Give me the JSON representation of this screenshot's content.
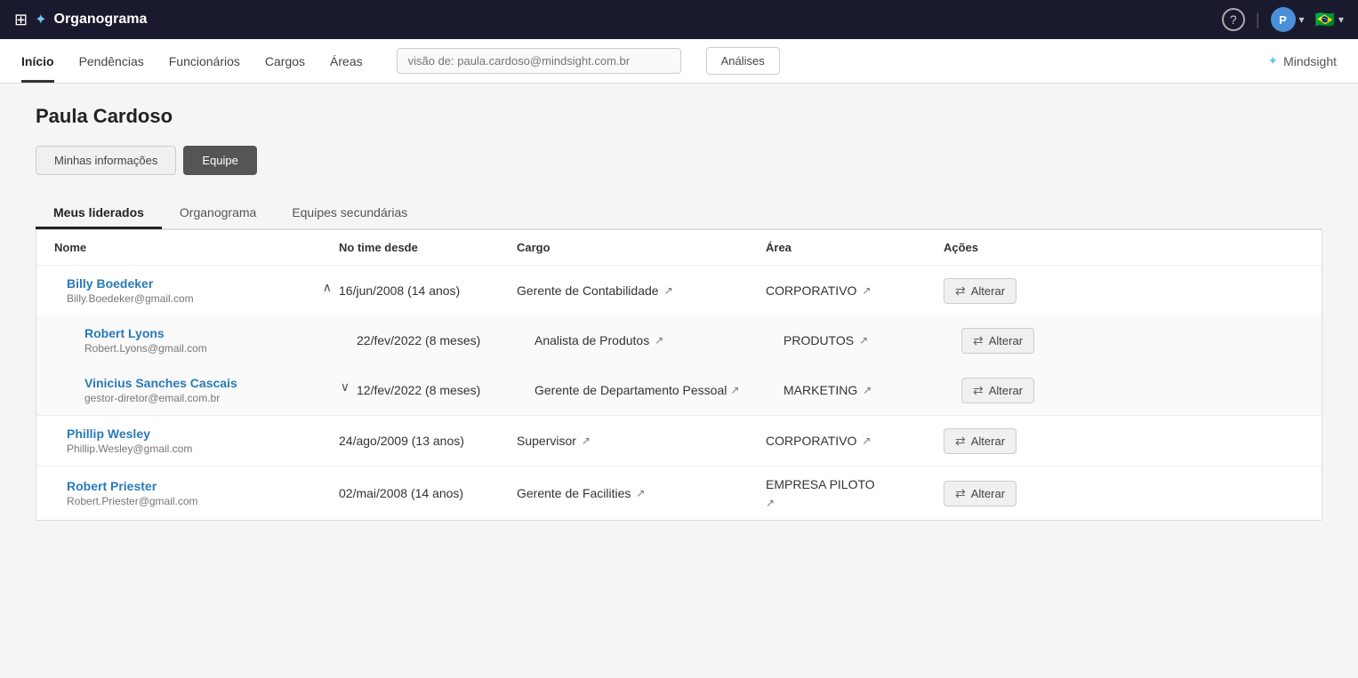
{
  "topbar": {
    "logo_icon": "⬛",
    "network_icon": "⬡",
    "title": "Organograma",
    "help_label": "?",
    "avatar_label": "P",
    "avatar_dropdown": "▾",
    "flag_emoji": "🇧🇷",
    "flag_dropdown": "▾"
  },
  "navbar": {
    "items": [
      {
        "label": "Início",
        "active": true
      },
      {
        "label": "Pendências",
        "active": false
      },
      {
        "label": "Funcionários",
        "active": false
      },
      {
        "label": "Cargos",
        "active": false
      },
      {
        "label": "Áreas",
        "active": false
      }
    ],
    "search_placeholder": "visão de: paula.cardoso@mindsight.com.br",
    "analyses_label": "Análises",
    "brand_label": "Mindsight",
    "brand_icon": "⬡"
  },
  "page": {
    "title": "Paula Cardoso",
    "tab_buttons": [
      {
        "label": "Minhas informações",
        "active": false
      },
      {
        "label": "Equipe",
        "active": true
      }
    ],
    "sub_tabs": [
      {
        "label": "Meus liderados",
        "active": true
      },
      {
        "label": "Organograma",
        "active": false
      },
      {
        "label": "Equipes secundárias",
        "active": false
      }
    ]
  },
  "table": {
    "headers": {
      "nome": "Nome",
      "desde": "No time desde",
      "cargo": "Cargo",
      "area": "Área",
      "acoes": "Ações"
    },
    "rows": [
      {
        "id": "billy",
        "name": "Billy Boedeker",
        "email": "Billy.Boedeker@gmail.com",
        "since": "16/jun/2008 (14 anos)",
        "cargo": "Gerente de Contabilidade",
        "area": "CORPORATIVO",
        "has_expand": true,
        "expanded": true,
        "indicator_color": "#2a7ab8",
        "sub_rows": [
          {
            "id": "robert",
            "name": "Robert Lyons",
            "email": "Robert.Lyons@gmail.com",
            "since": "22/fev/2022 (8 meses)",
            "cargo": "Analista de Produtos",
            "area": "PRODUTOS",
            "has_expand": false,
            "indicator_color": "#2a7ab8"
          },
          {
            "id": "vinicius",
            "name": "Vinicius Sanches Cascais",
            "email": "gestor-diretor@email.com.br",
            "since": "12/fev/2022 (8 meses)",
            "cargo": "Gerente de Departamento Pessoal",
            "area": "MARKETING",
            "has_expand": true,
            "expanded": false,
            "indicator_color": "#2a7ab8"
          }
        ]
      },
      {
        "id": "phillip",
        "name": "Phillip Wesley",
        "email": "Phillip.Wesley@gmail.com",
        "since": "24/ago/2009 (13 anos)",
        "cargo": "Supervisor",
        "area": "CORPORATIVO",
        "has_expand": false,
        "indicator_color": "#2a7ab8"
      },
      {
        "id": "robert-priester",
        "name": "Robert Priester",
        "email": "Robert.Priester@gmail.com",
        "since": "02/mai/2008 (14 anos)",
        "cargo": "Gerente de Facilities",
        "area": "EMPRESA PILOTO",
        "has_expand": false,
        "indicator_color": "#2a7ab8"
      }
    ],
    "alterar_label": "Alterar",
    "ext_icon": "↗"
  }
}
